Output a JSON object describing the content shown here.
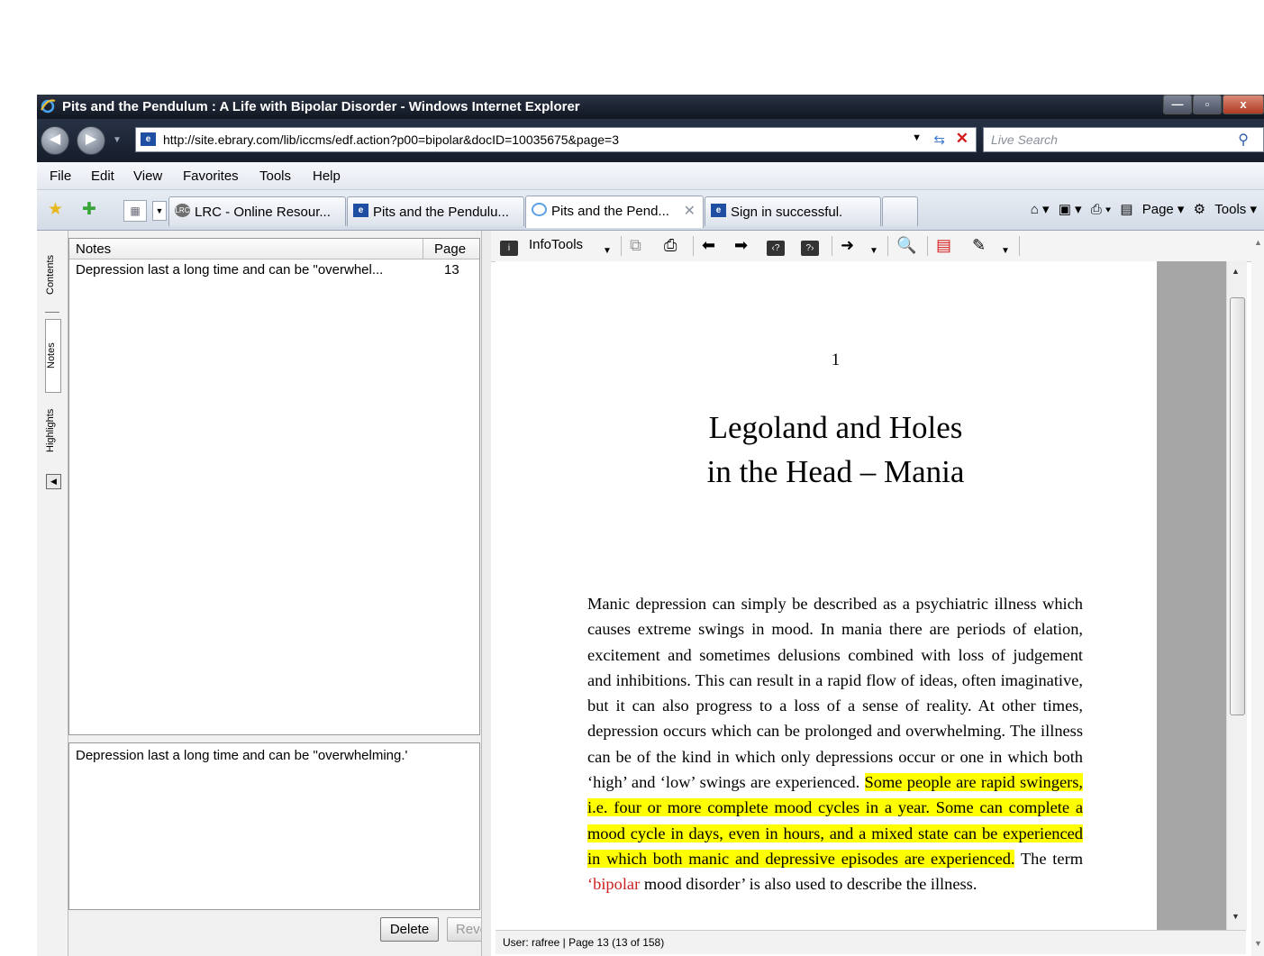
{
  "window": {
    "title": "Pits and the Pendulum : A Life with Bipolar Disorder - Windows Internet Explorer",
    "min": "—",
    "max": "▫",
    "close": "x"
  },
  "address": {
    "url": "http://site.ebrary.com/lib/iccms/edf.action?p00=bipolar&docID=10035675&page=3",
    "search_placeholder": "Live Search"
  },
  "menu": [
    "File",
    "Edit",
    "View",
    "Favorites",
    "Tools",
    "Help"
  ],
  "tabs": [
    {
      "label": "LRC - Online Resour...",
      "icon": "lrc-icon"
    },
    {
      "label": "Pits and the Pendulu...",
      "icon": "ebrary-icon"
    },
    {
      "label": "Pits and the Pend...",
      "icon": "loading-icon",
      "active": true
    },
    {
      "label": "Sign in successful.",
      "icon": "ebrary-icon"
    }
  ],
  "commandbar": {
    "page": "Page",
    "tools": "Tools"
  },
  "side_tabs": {
    "contents": "Contents",
    "notes": "Notes",
    "highlights": "Highlights"
  },
  "notes": {
    "col_notes": "Notes",
    "col_page": "Page",
    "rows": [
      {
        "text": "Depression last a long time and can be \"overwhel...",
        "page": "13"
      }
    ],
    "detail": "Depression last a long time and can be \"overwhelming.'",
    "delete": "Delete",
    "revert": "Revert"
  },
  "reader": {
    "infotools": "InfoTools",
    "chapter_number": "1",
    "chapter_title_line1": "Legoland and Holes",
    "chapter_title_line2": "in the Head – Mania",
    "para_normal": "Manic depression can simply be described as a psychiatric illness which causes extreme swings in mood. In mania there are periods of elation, excitement and sometimes delusions combined with loss of judgement and inhibitions. This can result in a rapid flow of ideas, often imaginative, but it can also progress to a loss of a sense of reality. At other times, depression occurs which can be prolonged and overwhelming. The illness can be of the kind in which only depressions occur or one in which both ‘high’ and ‘low’ swings are experienced.",
    "para_highlight": "Some people are rapid swingers, i.e. four or more complete mood cycles in a year. Some can complete a mood cycle in days, even in hours, and a mixed state can be experienced in which both manic and depressive episodes are experienced.",
    "para_after1": " The term ",
    "para_term": "‘bipolar",
    "para_after2": " mood disorder’ is also used to describe the illness.",
    "status": "User: rafree  |  Page 13 (13 of 158)"
  }
}
